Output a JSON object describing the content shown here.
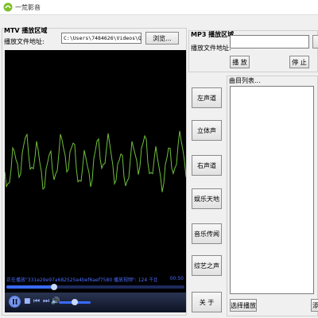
{
  "window": {
    "title": "一荒影音"
  },
  "mtv": {
    "section_label": "MTV 播放区域",
    "file_label": "播放文件地址:",
    "file_path": "C:\\Users\\7484626\\Videos\\QQplayerClip\\331e2",
    "browse_label": "浏览..."
  },
  "mp3": {
    "section_label": "MP3 播放区域",
    "file_label": "播放文件地址:",
    "file_path": "",
    "play_label": "播 放",
    "stop_label": "停 止"
  },
  "channels": {
    "left_label": "左声道",
    "stereo_label": "立体声",
    "right_label": "右声道",
    "entertainment_label": "娱乐天地",
    "music_label": "音乐传闻",
    "variety_label": "综艺之声",
    "about_label": "关 于"
  },
  "playlist": {
    "label": "曲目列表...",
    "select_play_label": "选择播放",
    "add_label": "添"
  },
  "player": {
    "status_text": "正在播放\"331e29e97a682525e4bef6aef7580 播放视频\": 124 千比特/秒",
    "time_text": "00:50",
    "seek_fraction": 0.27,
    "volume_fraction": 0.5,
    "wave_color": "#6fbf3a"
  },
  "icons": {
    "play": "play-icon",
    "stop": "stop-icon",
    "prev": "prev-icon",
    "next": "next-icon",
    "volume": "volume-icon"
  }
}
